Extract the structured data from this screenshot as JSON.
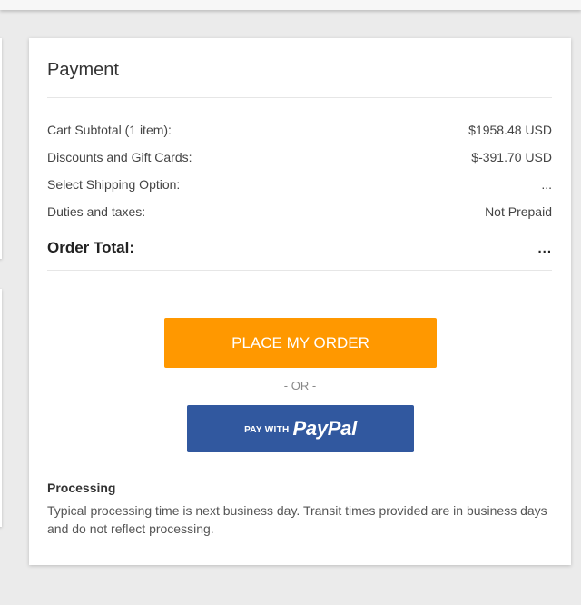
{
  "payment": {
    "title": "Payment",
    "rows": [
      {
        "label": "Cart Subtotal (1 item):",
        "value": "$1958.48 USD"
      },
      {
        "label": "Discounts and Gift Cards:",
        "value": "$-391.70 USD"
      },
      {
        "label": "Select Shipping Option:",
        "value": "..."
      },
      {
        "label": "Duties and taxes:",
        "value": "Not Prepaid"
      }
    ],
    "total": {
      "label": "Order Total:",
      "value": "..."
    },
    "place_order_label": "PLACE MY ORDER",
    "or_label": "- OR -",
    "paypal": {
      "prefix": "PAY WITH",
      "brand": "PayPal"
    },
    "processing": {
      "title": "Processing",
      "text": "Typical processing time is next business day. Transit times provided are in business days and do not reflect processing."
    }
  },
  "colors": {
    "place_order": "#ff9800",
    "paypal": "#31589f",
    "background": "#ebebeb"
  }
}
